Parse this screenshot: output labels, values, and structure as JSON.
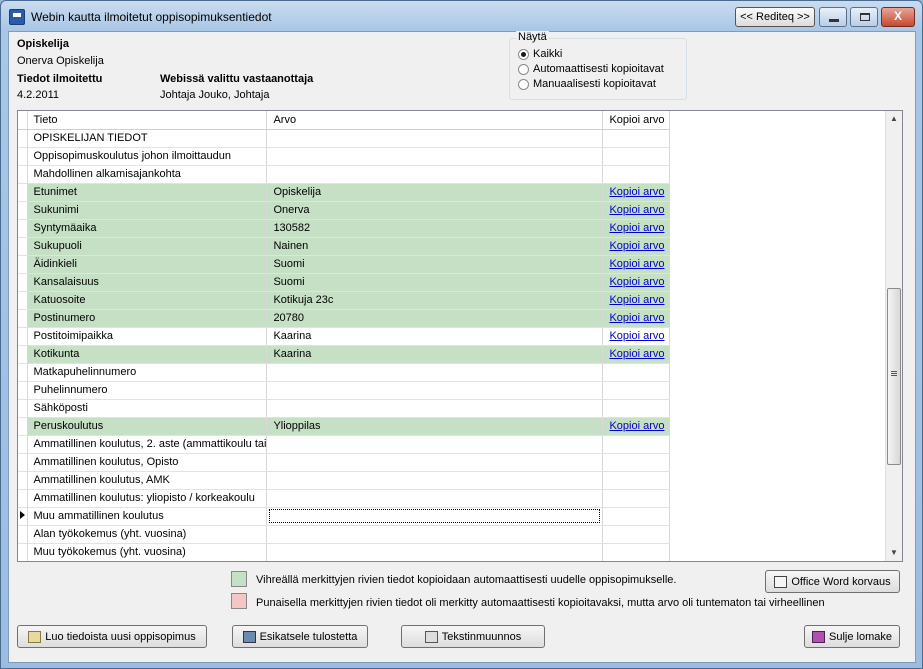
{
  "window": {
    "title": "Webin kautta ilmoitetut oppisopimuksentiedot",
    "rediteq_label": "<< Rediteq >>",
    "close_glyph": "X"
  },
  "header": {
    "student_label": "Opiskelija",
    "student_value": "Onerva Opiskelija",
    "reported_label": "Tiedot ilmoitettu",
    "reported_value": "4.2.2011",
    "recipient_label": "Webissä valittu vastaanottaja",
    "recipient_value": "Johtaja Jouko, Johtaja"
  },
  "show_group": {
    "title": "Näytä",
    "options": [
      {
        "label": "Kaikki",
        "selected": true
      },
      {
        "label": "Automaattisesti kopioitavat",
        "selected": false
      },
      {
        "label": "Manuaalisesti kopioitavat",
        "selected": false
      }
    ]
  },
  "grid": {
    "columns": [
      "Tieto",
      "Arvo",
      "Kopioi arvo"
    ],
    "rows": [
      {
        "tieto": "OPISKELIJAN TIEDOT",
        "arvo": "",
        "kopioi": "",
        "green": false
      },
      {
        "tieto": "Oppisopimuskoulutus johon ilmoittaudun",
        "arvo": "",
        "kopioi": "",
        "green": false
      },
      {
        "tieto": "Mahdollinen alkamisajankohta",
        "arvo": "",
        "kopioi": "",
        "green": false
      },
      {
        "tieto": "Etunimet",
        "arvo": "Opiskelija",
        "kopioi": "Kopioi arvo",
        "green": true
      },
      {
        "tieto": "Sukunimi",
        "arvo": "Onerva",
        "kopioi": "Kopioi arvo",
        "green": true
      },
      {
        "tieto": "Syntymäaika",
        "arvo": "130582",
        "kopioi": "Kopioi arvo",
        "green": true
      },
      {
        "tieto": "Sukupuoli",
        "arvo": "Nainen",
        "kopioi": "Kopioi arvo",
        "green": true
      },
      {
        "tieto": "Äidinkieli",
        "arvo": "Suomi",
        "kopioi": "Kopioi arvo",
        "green": true
      },
      {
        "tieto": "Kansalaisuus",
        "arvo": "Suomi",
        "kopioi": "Kopioi arvo",
        "green": true
      },
      {
        "tieto": "Katuosoite",
        "arvo": "Kotikuja 23c",
        "kopioi": "Kopioi arvo",
        "green": true
      },
      {
        "tieto": "Postinumero",
        "arvo": "20780",
        "kopioi": "Kopioi arvo",
        "green": true
      },
      {
        "tieto": "Postitoimipaikka",
        "arvo": "Kaarina",
        "kopioi": "Kopioi arvo",
        "green": false
      },
      {
        "tieto": "Kotikunta",
        "arvo": "Kaarina",
        "kopioi": "Kopioi arvo",
        "green": true
      },
      {
        "tieto": "Matkapuhelinnumero",
        "arvo": "",
        "kopioi": "",
        "green": false
      },
      {
        "tieto": "Puhelinnumero",
        "arvo": "",
        "kopioi": "",
        "green": false
      },
      {
        "tieto": "Sähköposti",
        "arvo": "",
        "kopioi": "",
        "green": false
      },
      {
        "tieto": "Peruskoulutus",
        "arvo": "Ylioppilas",
        "kopioi": "Kopioi arvo",
        "green": true
      },
      {
        "tieto": "Ammatillinen koulutus, 2. aste (ammattikoulu tai",
        "arvo": "",
        "kopioi": "",
        "green": false
      },
      {
        "tieto": "Ammatillinen koulutus, Opisto",
        "arvo": "",
        "kopioi": "",
        "green": false
      },
      {
        "tieto": "Ammatillinen koulutus, AMK",
        "arvo": "",
        "kopioi": "",
        "green": false
      },
      {
        "tieto": "Ammatillinen koulutus: yliopisto / korkeakoulu",
        "arvo": "",
        "kopioi": "",
        "green": false
      },
      {
        "tieto": "Muu ammatillinen koulutus",
        "arvo": "",
        "kopioi": "",
        "green": false,
        "current": true
      },
      {
        "tieto": "Alan työkokemus (yht. vuosina)",
        "arvo": "",
        "kopioi": "",
        "green": false
      },
      {
        "tieto": "Muu työkokemus (yht. vuosina)",
        "arvo": "",
        "kopioi": "",
        "green": false
      }
    ]
  },
  "legend": {
    "green_text": "Vihreällä merkittyjen rivien tiedot kopioidaan automaattisesti uudelle oppisopimukselle.",
    "red_text": "Punaisella merkittyjen rivien tiedot oli merkitty automaattisesti kopioitavaksi, mutta arvo oli tuntematon tai virheellinen",
    "green_color": "#c6e0c6",
    "red_color": "#f4c6c6"
  },
  "buttons": {
    "word": "Office Word korvaus",
    "create": "Luo tiedoista uusi oppisopimus",
    "preview": "Esikatsele tulostetta",
    "text_convert": "Tekstinmuunnos",
    "close_form": "Sulje lomake"
  },
  "icons": {
    "app": "app-icon",
    "word": "printer-icon",
    "create": "new-document-icon",
    "preview": "monitor-icon",
    "text_convert": "convert-icon",
    "close_form": "exit-door-icon"
  }
}
